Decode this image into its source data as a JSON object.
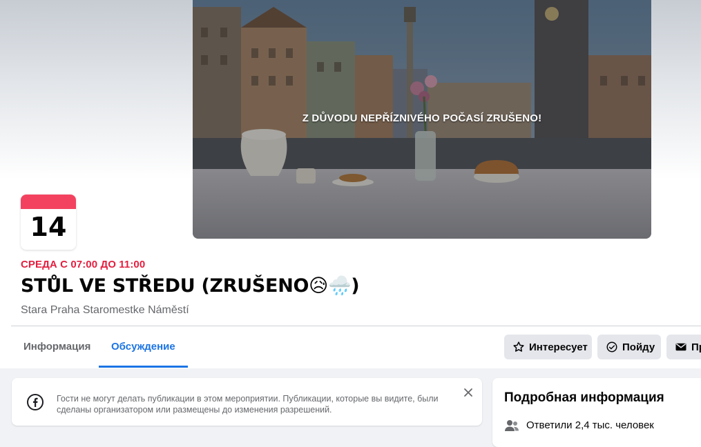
{
  "cover": {
    "overlay_text": "Z DŮVODU NEPŘÍZNIVÉHO POČASÍ ZRUŠENO!"
  },
  "date_badge": {
    "day": "14",
    "accent": "#f3425f"
  },
  "event": {
    "when": "СРЕДА С 07:00 ДО 11:00",
    "title": "STŮL VE STŘEDU (ZRUŠENO😥🌧️)",
    "location": "Stara Praha Staromestke Náměstí"
  },
  "tabs": [
    {
      "label": "Информация",
      "active": false
    },
    {
      "label": "Обсуждение",
      "active": true
    }
  ],
  "actions": {
    "interested": {
      "label": "Интересует",
      "icon": "star-icon"
    },
    "going": {
      "label": "Пойду",
      "icon": "check-circle-icon"
    },
    "invite": {
      "label": "Пр",
      "icon": "envelope-icon"
    }
  },
  "notice": {
    "icon": "facebook-icon",
    "text": "Гости не могут делать публикации в этом мероприятии. Публикации, которые вы видите, были сделаны организатором или размещены до изменения разрешений."
  },
  "details": {
    "heading": "Подробная информация",
    "responded": "Ответили 2,4 тыс. человек",
    "icon": "people-icon"
  },
  "colors": {
    "accent_blue": "#1b74e4",
    "date_red": "#e41e3f"
  }
}
